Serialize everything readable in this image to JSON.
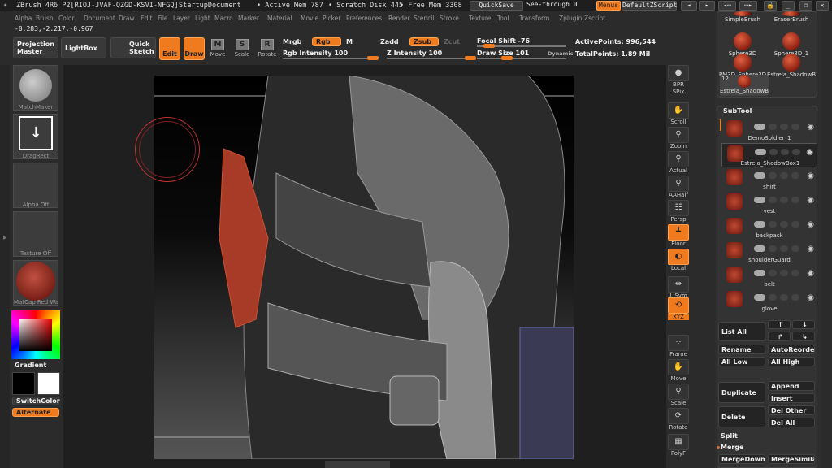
{
  "title": {
    "app": "ZBrush 4R6 P2[RIOJ-JVAF-QZGD-KSVI-NFGQ]",
    "document": "StartupDocument",
    "active_mem": "• Active Mem 787",
    "scratch": "• Scratch Disk 445",
    "free_mem": "• Free Mem 3308",
    "quicksave": "QuickSave",
    "see_through": "See-through  0",
    "menus": "Menus",
    "script": "DefaultZScript"
  },
  "menu": [
    "Alpha",
    "Brush",
    "Color",
    "Document",
    "Draw",
    "Edit",
    "File",
    "Layer",
    "Light",
    "Macro",
    "Marker",
    "Material",
    "Movie",
    "Picker",
    "Preferences",
    "Render",
    "Stencil",
    "Stroke",
    "Texture",
    "Tool",
    "Transform",
    "Zplugin",
    "Zscript"
  ],
  "coords": "-0.283,-2.217,-0.967",
  "toolbar": {
    "projection_master": "Projection Master",
    "lightbox": "LightBox",
    "quick_sketch": "Quick Sketch",
    "edit": "Edit",
    "draw": "Draw",
    "move": "Move",
    "scale": "Scale",
    "rotate": "Rotate",
    "mrgb": "Mrgb",
    "rgb": "Rgb",
    "m": "M",
    "rgb_intensity": "Rgb Intensity 100",
    "zadd": "Zadd",
    "zsub": "Zsub",
    "zcut": "Zcut",
    "z_intensity": "Z Intensity 100",
    "focal_shift": "Focal Shift -76",
    "draw_size": "Draw Size 101",
    "dynamic": "Dynamic",
    "active_points": "ActivePoints: 996,544",
    "total_points": "TotalPoints: 1.89 Mil"
  },
  "left_shelf": {
    "brush": "MatchMaker",
    "stroke": "DragRect",
    "alpha": "Alpha Off",
    "texture": "Texture Off",
    "material": "MatCap Red Wa",
    "gradient": "Gradient",
    "switch_color": "SwitchColor",
    "alternate": "Alternate",
    "main_color": "#000000",
    "secondary_color": "#ffffff"
  },
  "right_shelf": [
    "BPR",
    "SPix",
    "Scroll",
    "Zoom",
    "Actual",
    "AAHalf",
    "Persp",
    "Floor",
    "Local",
    "L.Sym",
    "XYZ",
    "Frame",
    "Move",
    "Scale",
    "Rotate",
    "PolyF"
  ],
  "tools": {
    "items": [
      "SimpleBrush",
      "EraserBrush",
      "Sphere3D",
      "Sphere3D_1",
      "PM3D_Sphere3D",
      "Estrela_ShadowB"
    ],
    "current": "Estrela_ShadowB",
    "current_count": "12"
  },
  "subtool": {
    "title": "SubTool",
    "items": [
      "DemoSoldier_1",
      "Estrela_ShadowBox1",
      "shirt",
      "vest",
      "backpack",
      "shoulderGuard",
      "belt",
      "glove"
    ],
    "selected": "Estrela_ShadowBox1"
  },
  "subtool_buttons": {
    "list_all": "List All",
    "rename": "Rename",
    "auto_reorder": "AutoReorder",
    "all_low": "All Low",
    "all_high": "All High",
    "duplicate": "Duplicate",
    "append": "Append",
    "insert": "Insert",
    "delete": "Delete",
    "del_other": "Del Other",
    "del_all": "Del All",
    "split": "Split",
    "merge": "Merge",
    "merge_down": "MergeDown",
    "merge_similar": "MergeSimilar"
  },
  "colors": {
    "accent": "#f07a1e",
    "panel": "#333333",
    "brush_ring": "#c03030"
  }
}
